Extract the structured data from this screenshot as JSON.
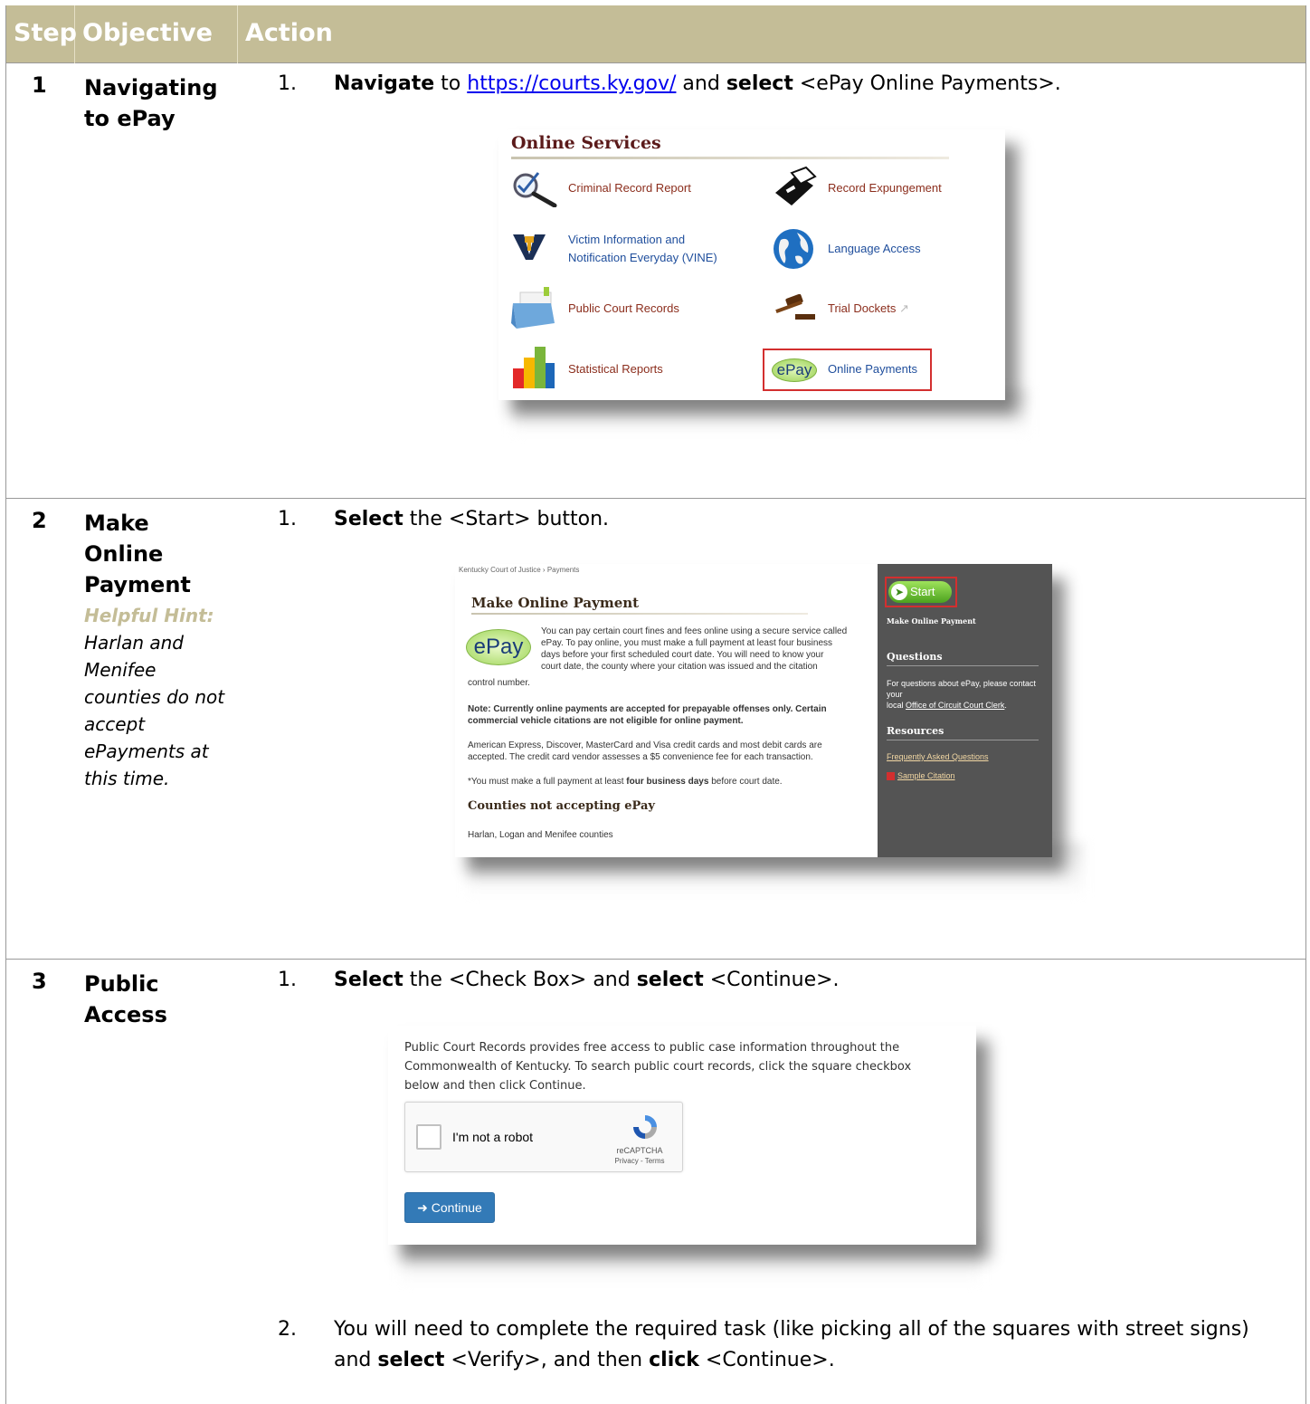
{
  "header": {
    "col_step": "Step",
    "col_objective": "Objective",
    "col_action": "Action"
  },
  "steps": [
    {
      "number": "1",
      "objective": "Navigating to ePay",
      "action_num": "1.",
      "action_bold1": "Navigate",
      "action_to": " to ",
      "action_link": "https://courts.ky.gov/",
      "action_and": " and ",
      "action_bold2": "select",
      "action_rest": " <ePay Online Payments>."
    },
    {
      "number": "2",
      "objective": "Make Online Payment",
      "hint_title": "Helpful Hint:",
      "hint_text": "Harlan and Menifee counties do not accept ePayments at this time.",
      "action_num": "1.",
      "action_bold": "Select",
      "action_rest": " the <Start> button."
    },
    {
      "number": "3",
      "objective": "Public Access",
      "action1_num": "1.",
      "action1_bold1": "Select",
      "action1_mid": " the <Check Box> and ",
      "action1_bold2": "select",
      "action1_rest": " <Continue>.",
      "action2_num": "2.",
      "action2_text1": "You will need to complete the required task (like picking all of the squares with street signs) and ",
      "action2_bold1": "select",
      "action2_text2": " <Verify>, and then ",
      "action2_bold2": "click",
      "action2_text3": " <Continue>."
    }
  ],
  "online_services": {
    "title": "Online Services",
    "items": [
      {
        "label": "Criminal Record Report",
        "icon": "magnifier-check-icon"
      },
      {
        "label": "Record Expungement",
        "icon": "eraser-icon"
      },
      {
        "label": "Victim Information and Notification Everyday (VINE)",
        "icon": "vine-icon"
      },
      {
        "label": "Language Access",
        "icon": "globe-icon"
      },
      {
        "label": "Public Court Records",
        "icon": "file-box-icon"
      },
      {
        "label": "Trial Dockets",
        "icon": "gavel-icon"
      },
      {
        "label": "Statistical Reports",
        "icon": "bar-chart-icon"
      },
      {
        "label": "Online Payments",
        "icon": "epay-logo"
      }
    ],
    "epay_logo": "ePay"
  },
  "make_payment": {
    "breadcrumb": "Kentucky Court of Justice  ›  Payments",
    "title": "Make Online Payment",
    "epay_logo": "ePay",
    "intro_line1": "You can pay certain court fines and fees online using a secure service called",
    "intro_line2": "ePay. To pay online, you must make a full payment at least four business",
    "intro_line3": "days before your first scheduled court date. You will need to know your",
    "intro_line4": "court date, the county where your citation was issued and the citation",
    "intro_line5": "control number.",
    "note_line1": "Note: Currently online payments are accepted for prepayable offenses only. Certain",
    "note_line2": "commercial vehicle citations are not eligible for online payment.",
    "cards_line1": "American Express, Discover, MasterCard and Visa credit cards and most debit cards are",
    "cards_line2": "accepted. The credit card vendor assesses a $5 convenience fee for each transaction.",
    "must_pre": "*You must make a full payment at least ",
    "must_bold": "four business days",
    "must_post": " before court date.",
    "counties_title": "Counties not accepting ePay",
    "counties_text": "Harlan, Logan and Menifee counties",
    "side_start": "Start",
    "side_make": "Make Online Payment",
    "side_questions": "Questions",
    "side_q_line1": "For questions about ePay, please contact your",
    "side_q_pre": "local ",
    "side_q_link": "Office of Circuit Court Clerk",
    "side_q_post": ".",
    "side_resources": "Resources",
    "side_faq": "Frequently Asked Questions",
    "side_sample": "Sample Citation"
  },
  "public_access": {
    "text": "Public Court Records provides free access to public case information throughout the Commonwealth of Kentucky. To search public court records, click the square checkbox below and then click Continue.",
    "robot_label": "I'm not a robot",
    "recaptcha": "reCAPTCHA",
    "privacy_terms": "Privacy - Terms",
    "continue_label": "Continue"
  },
  "colors": {
    "header_bg": "#c4bd97",
    "hint": "#c4bd97",
    "highlight": "#d32f2f"
  }
}
